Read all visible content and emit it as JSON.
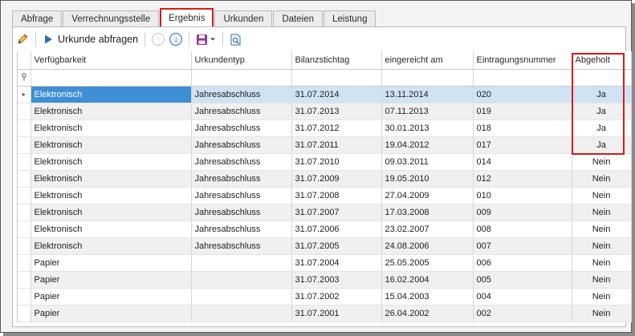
{
  "tabs": [
    {
      "label": "Abfrage"
    },
    {
      "label": "Verrechnungsstelle"
    },
    {
      "label": "Ergebnis",
      "active": true
    },
    {
      "label": "Urkunden"
    },
    {
      "label": "Dateien"
    },
    {
      "label": "Leistung"
    }
  ],
  "toolbar": {
    "edit_icon": "pencil-icon",
    "query_label": "Urkunde abfragen",
    "up_icon": "arrow-up-circle-icon",
    "down_icon": "arrow-down-circle-icon",
    "save_icon": "save-dropdown-icon",
    "preview_icon": "document-search-icon"
  },
  "grid": {
    "columns": [
      "Verfügbarkeit",
      "Urkundentyp",
      "Bilanzstichtag",
      "eingereicht am",
      "Eintragungsnummer",
      "Abgeholt"
    ],
    "filter_icon": "filter-pin-icon",
    "selected_row_marker": "▸",
    "rows": [
      [
        "Elektronisch",
        "Jahresabschluss",
        "31.07.2014",
        "13.11.2014",
        "020",
        "Ja"
      ],
      [
        "Elektronisch",
        "Jahresabschluss",
        "31.07.2013",
        "07.11.2013",
        "019",
        "Ja"
      ],
      [
        "Elektronisch",
        "Jahresabschluss",
        "31.07.2012",
        "30.01.2013",
        "018",
        "Ja"
      ],
      [
        "Elektronisch",
        "Jahresabschluss",
        "31.07.2011",
        "19.04.2012",
        "017",
        "Ja"
      ],
      [
        "Elektronisch",
        "Jahresabschluss",
        "31.07.2010",
        "09.03.2011",
        "014",
        "Nein"
      ],
      [
        "Elektronisch",
        "Jahresabschluss",
        "31.07.2009",
        "19.05.2010",
        "012",
        "Nein"
      ],
      [
        "Elektronisch",
        "Jahresabschluss",
        "31.07.2008",
        "27.04.2009",
        "010",
        "Nein"
      ],
      [
        "Elektronisch",
        "Jahresabschluss",
        "31.07.2007",
        "17.03.2008",
        "009",
        "Nein"
      ],
      [
        "Elektronisch",
        "Jahresabschluss",
        "31.07.2006",
        "23.02.2007",
        "008",
        "Nein"
      ],
      [
        "Elektronisch",
        "Jahresabschluss",
        "31.07.2005",
        "24.08.2006",
        "007",
        "Nein"
      ],
      [
        "Papier",
        "",
        "31.07.2004",
        "25.05.2005",
        "006",
        "Nein"
      ],
      [
        "Papier",
        "",
        "31.07.2003",
        "16.02.2004",
        "005",
        "Nein"
      ],
      [
        "Papier",
        "",
        "31.07.2002",
        "15.04.2003",
        "004",
        "Nein"
      ],
      [
        "Papier",
        "",
        "31.07.2001",
        "26.04.2002",
        "002",
        "Nein"
      ]
    ]
  },
  "colors": {
    "highlight": "#d41c1c",
    "selection": "#3f8fd6",
    "selection_row": "#cfe3f5"
  }
}
